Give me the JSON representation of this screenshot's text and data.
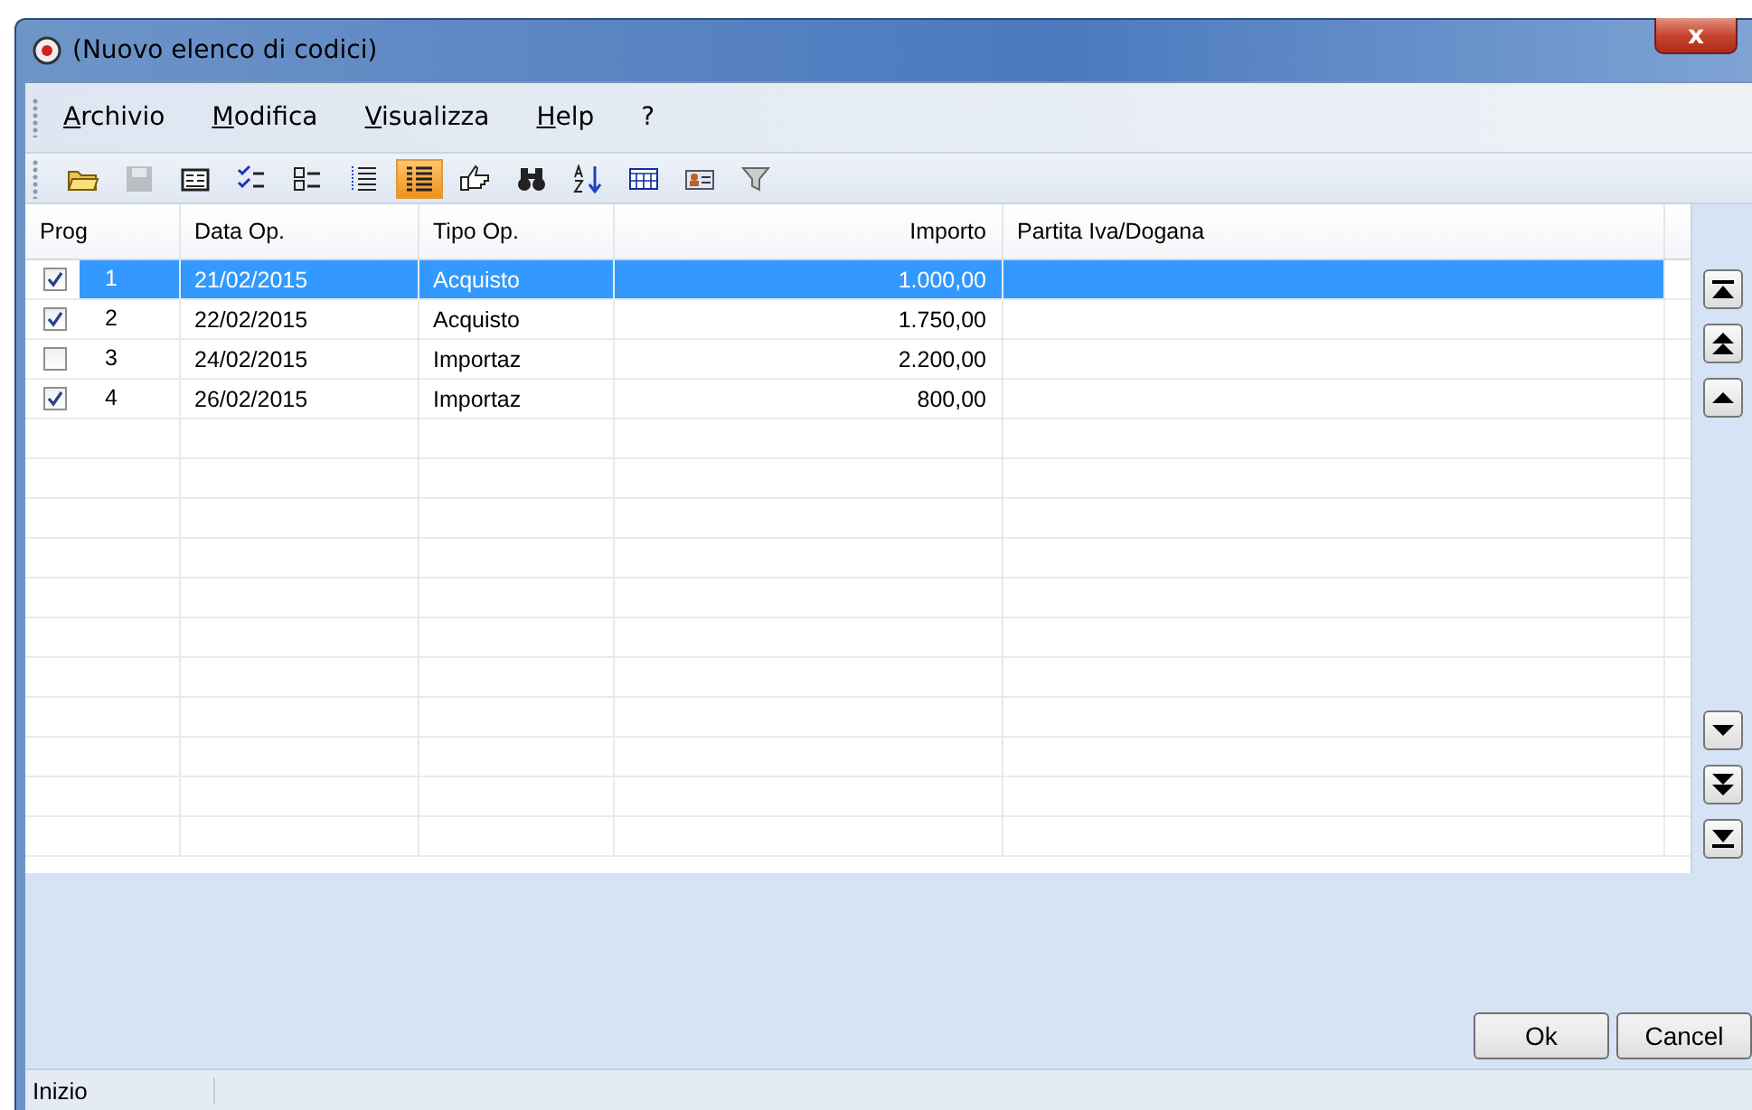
{
  "window": {
    "title": "(Nuovo elenco di codici)",
    "close": "x"
  },
  "menu": [
    {
      "label": "Archivio"
    },
    {
      "label": "Modifica"
    },
    {
      "label": "Visualizza"
    },
    {
      "label": "Help"
    },
    {
      "label": "?"
    }
  ],
  "toolbar": [
    {
      "kind": "open",
      "selected": false,
      "disabled": false
    },
    {
      "kind": "save",
      "selected": false,
      "disabled": true
    },
    {
      "kind": "form",
      "selected": false,
      "disabled": false
    },
    {
      "kind": "checklist",
      "selected": false,
      "disabled": false
    },
    {
      "kind": "list",
      "selected": false,
      "disabled": false
    },
    {
      "kind": "dotlist",
      "selected": false,
      "disabled": false
    },
    {
      "kind": "biglist",
      "selected": true,
      "disabled": false
    },
    {
      "kind": "thumb",
      "selected": false,
      "disabled": false
    },
    {
      "kind": "find",
      "selected": false,
      "disabled": false
    },
    {
      "kind": "sort",
      "selected": false,
      "disabled": false
    },
    {
      "kind": "grid",
      "selected": false,
      "disabled": false
    },
    {
      "kind": "card",
      "selected": false,
      "disabled": false
    },
    {
      "kind": "filter",
      "selected": false,
      "disabled": false
    }
  ],
  "table": {
    "columns": [
      "Prog",
      "Data Op.",
      "Tipo Op.",
      "Importo",
      "Partita Iva/Dogana"
    ],
    "rows": [
      {
        "checked": true,
        "selected": true,
        "cells": [
          "1",
          "21/02/2015",
          "Acquisto",
          "1.000,00",
          ""
        ]
      },
      {
        "checked": true,
        "selected": false,
        "cells": [
          "2",
          "22/02/2015",
          "Acquisto",
          "1.750,00",
          ""
        ]
      },
      {
        "checked": false,
        "selected": false,
        "cells": [
          "3",
          "24/02/2015",
          "Importaz",
          "2.200,00",
          ""
        ]
      },
      {
        "checked": true,
        "selected": false,
        "cells": [
          "4",
          "26/02/2015",
          "Importaz",
          "800,00",
          ""
        ]
      }
    ]
  },
  "nav_top": [
    {
      "kind": "first"
    },
    {
      "kind": "pageup"
    },
    {
      "kind": "up"
    }
  ],
  "nav_bottom": [
    {
      "kind": "down"
    },
    {
      "kind": "pagedown"
    },
    {
      "kind": "last"
    }
  ],
  "buttons": [
    "Ok",
    "Cancel"
  ],
  "status_bar": "Inizio"
}
